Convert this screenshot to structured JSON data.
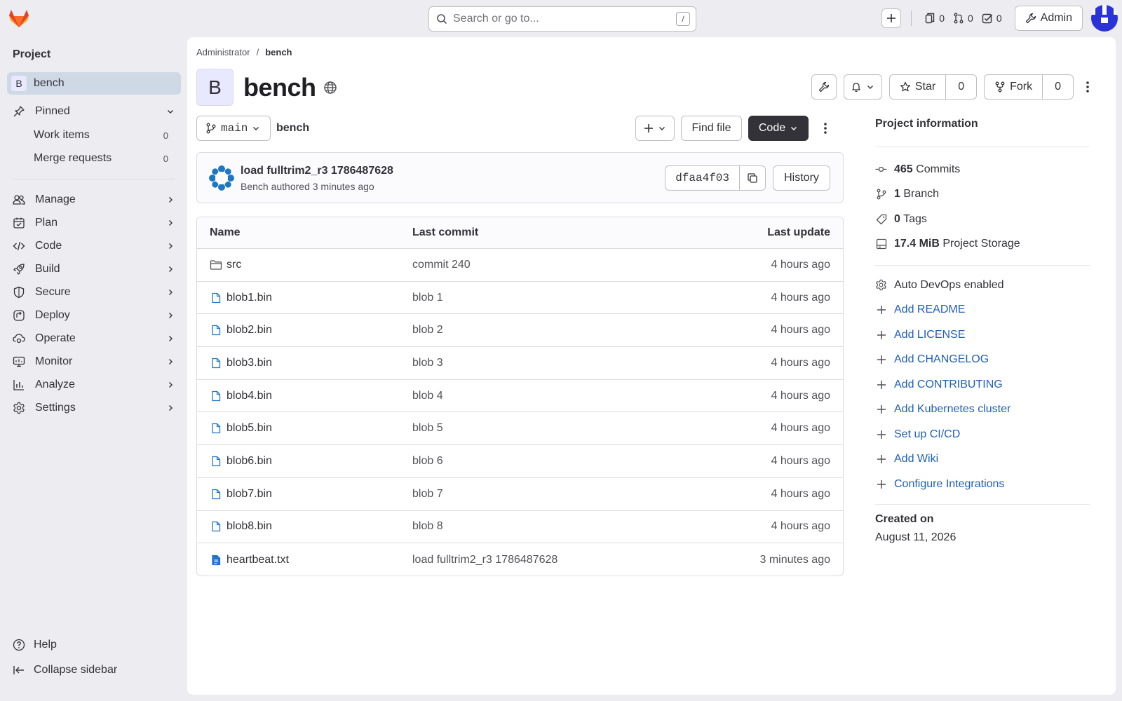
{
  "topbar": {
    "search_placeholder": "Search or go to...",
    "search_shortcut": "/",
    "issues_count": "0",
    "mr_count": "0",
    "todos_count": "0",
    "admin_label": "Admin"
  },
  "sidebar": {
    "title": "Project",
    "project_initial": "B",
    "project_name": "bench",
    "pinned_label": "Pinned",
    "pinned_items": [
      {
        "label": "Work items",
        "count": "0"
      },
      {
        "label": "Merge requests",
        "count": "0"
      }
    ],
    "nav": [
      "Manage",
      "Plan",
      "Code",
      "Build",
      "Secure",
      "Deploy",
      "Operate",
      "Monitor",
      "Analyze",
      "Settings"
    ],
    "help_label": "Help",
    "collapse_label": "Collapse sidebar"
  },
  "breadcrumb": {
    "parent": "Administrator",
    "separator": "/",
    "current": "bench"
  },
  "project": {
    "initial": "B",
    "name": "bench",
    "star_label": "Star",
    "star_count": "0",
    "fork_label": "Fork",
    "fork_count": "0"
  },
  "repo": {
    "branch": "main",
    "path": "bench",
    "find_file_label": "Find file",
    "code_label": "Code"
  },
  "last_commit": {
    "title": "load fulltrim2_r3 1786487628",
    "meta": "Bench authored 3 minutes ago",
    "sha": "dfaa4f03",
    "history_label": "History"
  },
  "files": {
    "headers": {
      "name": "Name",
      "last_commit": "Last commit",
      "last_update": "Last update"
    },
    "rows": [
      {
        "type": "folder",
        "name": "src",
        "commit": "commit 240",
        "updated": "4 hours ago"
      },
      {
        "type": "file",
        "name": "blob1.bin",
        "commit": "blob 1",
        "updated": "4 hours ago"
      },
      {
        "type": "file",
        "name": "blob2.bin",
        "commit": "blob 2",
        "updated": "4 hours ago"
      },
      {
        "type": "file",
        "name": "blob3.bin",
        "commit": "blob 3",
        "updated": "4 hours ago"
      },
      {
        "type": "file",
        "name": "blob4.bin",
        "commit": "blob 4",
        "updated": "4 hours ago"
      },
      {
        "type": "file",
        "name": "blob5.bin",
        "commit": "blob 5",
        "updated": "4 hours ago"
      },
      {
        "type": "file",
        "name": "blob6.bin",
        "commit": "blob 6",
        "updated": "4 hours ago"
      },
      {
        "type": "file",
        "name": "blob7.bin",
        "commit": "blob 7",
        "updated": "4 hours ago"
      },
      {
        "type": "file",
        "name": "blob8.bin",
        "commit": "blob 8",
        "updated": "4 hours ago"
      },
      {
        "type": "text",
        "name": "heartbeat.txt",
        "commit": "load fulltrim2_r3 1786487628",
        "updated": "3 minutes ago"
      }
    ]
  },
  "project_info": {
    "title": "Project information",
    "commits_count": "465",
    "commits_label": "Commits",
    "branch_count": "1",
    "branch_label": "Branch",
    "tags_count": "0",
    "tags_label": "Tags",
    "storage_size": "17.4 MiB",
    "storage_label": "Project Storage",
    "auto_devops": "Auto DevOps enabled",
    "links": [
      "Add README",
      "Add LICENSE",
      "Add CHANGELOG",
      "Add CONTRIBUTING",
      "Add Kubernetes cluster",
      "Set up CI/CD",
      "Add Wiki",
      "Configure Integrations"
    ],
    "created_title": "Created on",
    "created_date": "August 11, 2026"
  },
  "colors": {
    "accent": "#1f5fb8",
    "sidebar_active": "#cfd9e6",
    "code_button": "#333238",
    "gitlab_orange": "#e24329"
  }
}
